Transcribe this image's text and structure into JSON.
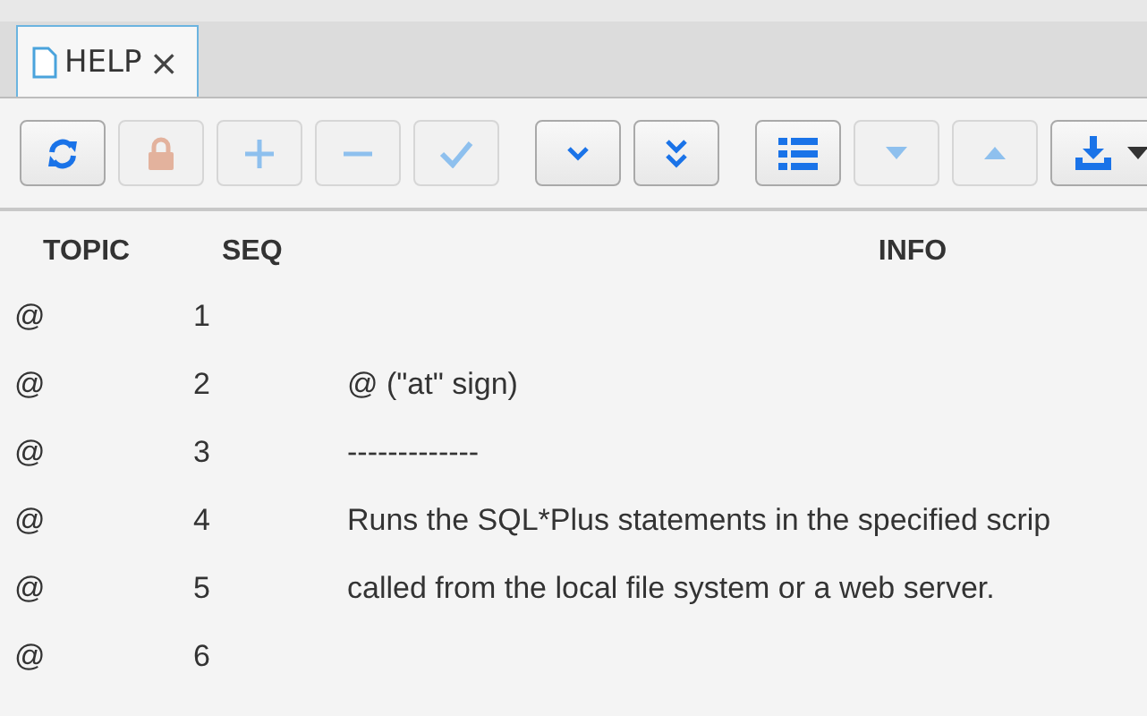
{
  "tabs": [
    {
      "label": "HELP",
      "close": "×",
      "selected": true
    }
  ],
  "toolbar": [
    [
      {
        "kind": "refresh",
        "disabled": false
      },
      {
        "kind": "lock",
        "disabled": true
      },
      {
        "kind": "add",
        "disabled": true
      },
      {
        "kind": "remove",
        "disabled": true
      },
      {
        "kind": "check",
        "disabled": true
      }
    ],
    [
      {
        "kind": "down",
        "disabled": false
      },
      {
        "kind": "down-double",
        "disabled": false
      }
    ],
    [
      {
        "kind": "list",
        "disabled": false
      },
      {
        "kind": "triangle-down",
        "disabled": true
      },
      {
        "kind": "triangle-up",
        "disabled": true
      },
      {
        "kind": "download",
        "disabled": false
      }
    ]
  ],
  "table": {
    "columns": [
      "TOPIC",
      "SEQ",
      "INFO"
    ],
    "rows": [
      [
        "@",
        "1",
        ""
      ],
      [
        "@",
        "2",
        "@ (\"at\" sign)"
      ],
      [
        "@",
        "3",
        "-------------"
      ],
      [
        "@",
        "4",
        "Runs the SQL*Plus statements in the specified scrip"
      ],
      [
        "@",
        "5",
        "called from the local file system or a web server."
      ],
      [
        "@",
        "6",
        ""
      ]
    ]
  }
}
